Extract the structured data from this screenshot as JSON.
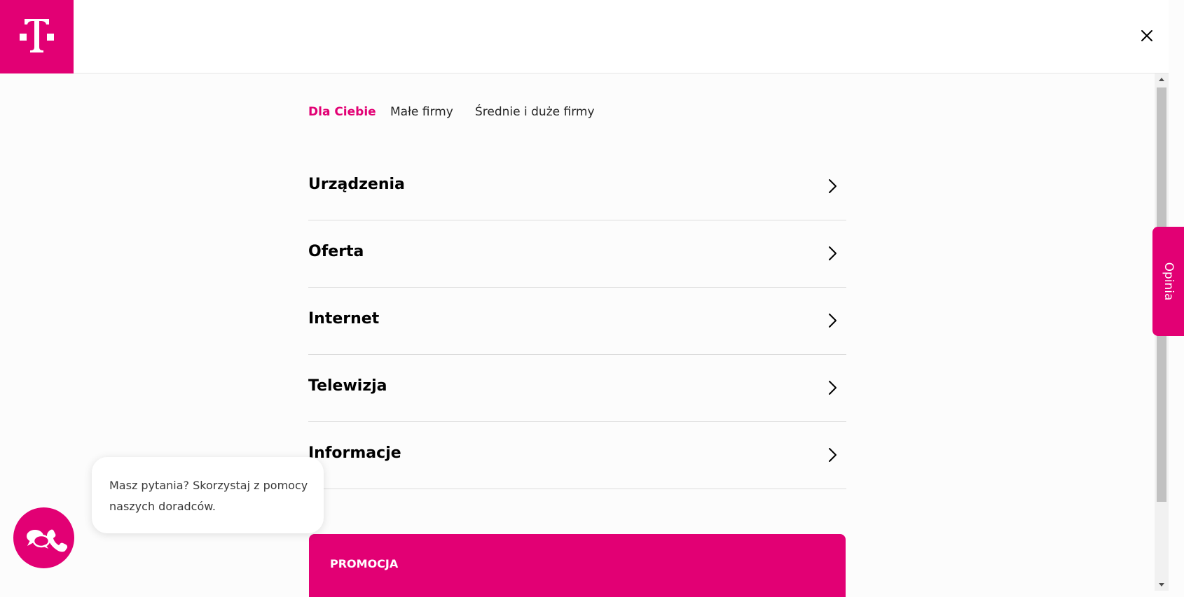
{
  "header": {
    "logo_icon": "telekom-t-logo",
    "close_icon": "close-icon"
  },
  "tabs": [
    {
      "label": "Dla Ciebie",
      "active": true
    },
    {
      "label": "Małe firmy",
      "active": false
    },
    {
      "label": "Średnie i duże firmy",
      "active": false
    }
  ],
  "menu": {
    "items": [
      {
        "label": "Urządzenia"
      },
      {
        "label": "Oferta"
      },
      {
        "label": "Internet"
      },
      {
        "label": "Telewizja"
      },
      {
        "label": "Informacje"
      }
    ]
  },
  "promo": {
    "label": "PROMOCJA"
  },
  "feedback": {
    "label": "Opinia"
  },
  "chat": {
    "message": "Masz pytania? Skorzystaj z pomocy naszych doradców.",
    "icon": "chat-phone-icon"
  },
  "colors": {
    "brand": "#e20074",
    "background": "#fcfcfc",
    "divider": "#dcdcdc"
  }
}
